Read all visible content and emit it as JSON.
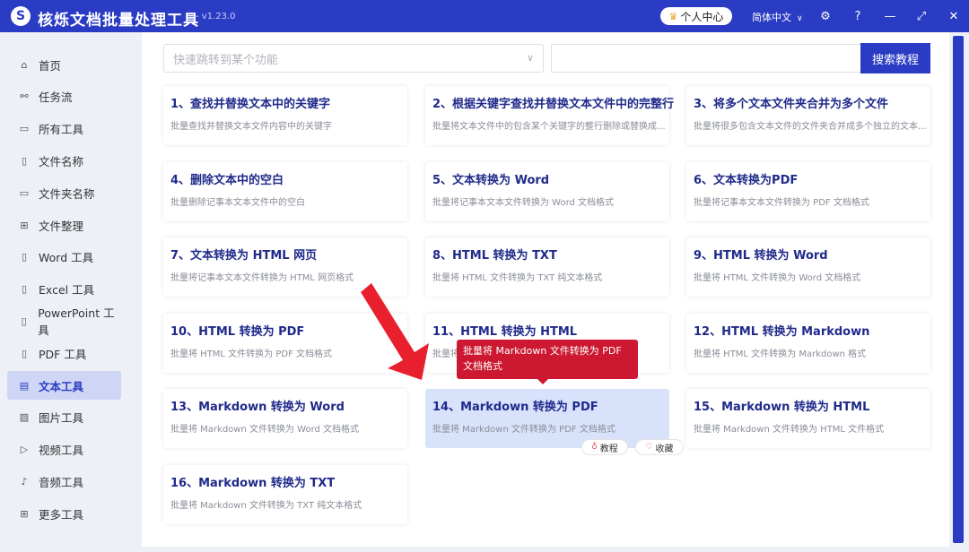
{
  "titlebar": {
    "logo_letter": "S",
    "title": "核烁文档批量处理工具",
    "version": "- v1.23.0",
    "user_center": "个人中心",
    "language": "简体中文"
  },
  "sidebar": {
    "items": [
      {
        "label": "首页",
        "icon": "home-icon",
        "glyph": "⌂"
      },
      {
        "label": "任务流",
        "icon": "flow-icon",
        "glyph": "⚯"
      },
      {
        "label": "所有工具",
        "icon": "monitor-icon",
        "glyph": "▭"
      },
      {
        "label": "文件名称",
        "icon": "file-icon",
        "glyph": "▯"
      },
      {
        "label": "文件夹名称",
        "icon": "folder-icon",
        "glyph": "▭"
      },
      {
        "label": "文件整理",
        "icon": "organize-icon",
        "glyph": "⊞"
      },
      {
        "label": "Word 工具",
        "icon": "word-icon",
        "glyph": "▯"
      },
      {
        "label": "Excel 工具",
        "icon": "excel-icon",
        "glyph": "▯"
      },
      {
        "label": "PowerPoint 工具",
        "icon": "ppt-icon",
        "glyph": "▯"
      },
      {
        "label": "PDF 工具",
        "icon": "pdf-icon",
        "glyph": "▯"
      },
      {
        "label": "文本工具",
        "icon": "text-icon",
        "glyph": "▤"
      },
      {
        "label": "图片工具",
        "icon": "image-icon",
        "glyph": "▨"
      },
      {
        "label": "视频工具",
        "icon": "video-icon",
        "glyph": "▷"
      },
      {
        "label": "音频工具",
        "icon": "audio-icon",
        "glyph": "♪"
      },
      {
        "label": "更多工具",
        "icon": "grid-icon",
        "glyph": "⊞"
      }
    ],
    "active_index": 10
  },
  "search": {
    "placeholder": "快速跳转到某个功能",
    "button": "搜索教程"
  },
  "cards": [
    {
      "title": "1、查找并替换文本中的关键字",
      "desc": "批量查找并替换文本文件内容中的关键字"
    },
    {
      "title": "2、根据关键字查找并替换文本文件中的完整行",
      "desc": "批量将文本文件中的包含某个关键字的整行删除或替换成..."
    },
    {
      "title": "3、将多个文本文件夹合并为多个文件",
      "desc": "批量将很多包含文本文件的文件夹合并成多个独立的文本..."
    },
    {
      "title": "4、删除文本中的空白",
      "desc": "批量删除记事本文本文件中的空白"
    },
    {
      "title": "5、文本转换为 Word",
      "desc": "批量将记事本文本文件转换为 Word 文档格式"
    },
    {
      "title": "6、文本转换为PDF",
      "desc": "批量将记事本文本文件转换为 PDF 文档格式"
    },
    {
      "title": "7、文本转换为 HTML 网页",
      "desc": "批量将记事本文本文件转换为 HTML 网页格式"
    },
    {
      "title": "8、HTML 转换为 TXT",
      "desc": "批量将 HTML 文件转换为 TXT 纯文本格式"
    },
    {
      "title": "9、HTML 转换为 Word",
      "desc": "批量将 HTML 文件转换为 Word 文档格式"
    },
    {
      "title": "10、HTML 转换为 PDF",
      "desc": "批量将 HTML 文件转换为 PDF 文档格式"
    },
    {
      "title": "11、HTML 转换为 HTML",
      "desc": "批量将 HTML 文件转换为 HTML 格式"
    },
    {
      "title": "12、HTML 转换为 Markdown",
      "desc": "批量将 HTML 文件转换为 Markdown 格式"
    },
    {
      "title": "13、Markdown 转换为 Word",
      "desc": "批量将 Markdown 文件转换为 Word 文档格式"
    },
    {
      "title": "14、Markdown 转换为 PDF",
      "desc": "批量将 Markdown 文件转换为 PDF 文档格式"
    },
    {
      "title": "15、Markdown 转换为 HTML",
      "desc": "批量将 Markdown 文件转换为 HTML 文件格式"
    },
    {
      "title": "16、Markdown 转换为 TXT",
      "desc": "批量将 Markdown 文件转换为 TXT 纯文本格式"
    }
  ],
  "hover_card": {
    "tooltip": "批量将 Markdown 文件转换为 PDF 文档格式",
    "tutorial": "教程",
    "favorite": "收藏"
  },
  "colors": {
    "accent": "#2b3cc4",
    "tooltip": "#cc1830",
    "arrow": "#e8202e"
  }
}
